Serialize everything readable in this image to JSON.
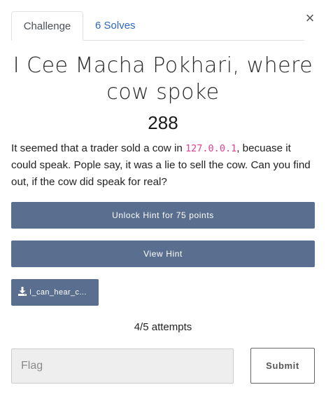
{
  "tabs": {
    "challenge": "Challenge",
    "solves": "6 Solves"
  },
  "close_symbol": "×",
  "challenge": {
    "title": "I Cee Macha Pokhari, where cow spoke",
    "points": "288",
    "description": {
      "before": "It seemed that a trader sold a cow in ",
      "code": "127.0.0.1",
      "after": ", becuase it could speak. Pople say, it was a lie to sell the cow. Can you find out, if the cow did speak for real?"
    }
  },
  "hints": {
    "unlock_label": "Unlock Hint for 75 points",
    "view_label": "View Hint"
  },
  "file": {
    "icon": "download-icon",
    "label": "I_can_hear_c..."
  },
  "attempts": "4/5 attempts",
  "flag": {
    "placeholder": "Flag",
    "value": ""
  },
  "submit_label": "Submit",
  "colors": {
    "button_bg": "#5a6f8f",
    "link": "#2e67c0",
    "code": "#e83e8c"
  }
}
